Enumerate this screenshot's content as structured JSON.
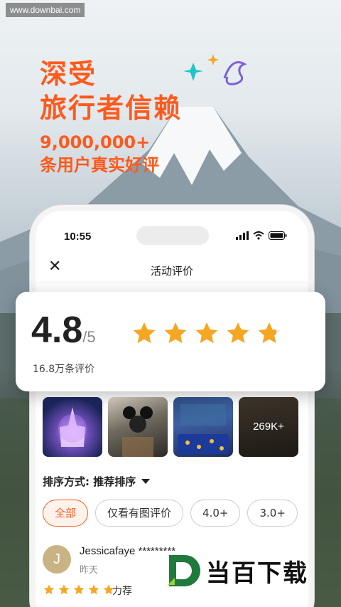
{
  "watermark": "www.downbai.com",
  "headline": {
    "line1": "深受",
    "line2": "旅行者信赖",
    "line3": "9,000,000+",
    "line4": "条用户真实好评"
  },
  "colors": {
    "accent": "#ff5a1c",
    "star": "#f5a623"
  },
  "status_bar": {
    "time": "10:55",
    "icons": [
      "signal-icon",
      "wifi-icon",
      "battery-icon"
    ]
  },
  "nav": {
    "title": "活动评价",
    "close_icon": "close-icon"
  },
  "rating": {
    "score": "4.8",
    "out_of": "/5",
    "count": "16.8万条评价",
    "stars": 4.8
  },
  "photos": [
    {
      "alt": "castle-night"
    },
    {
      "alt": "mickey-ears-crowd"
    },
    {
      "alt": "ride-interior"
    },
    {
      "alt": "food-photo",
      "overlay": "269K+"
    }
  ],
  "sort": {
    "label": "排序方式: 推荐排序"
  },
  "filters": [
    "全部",
    "仅看有图评价",
    "4.0+",
    "3.0+"
  ],
  "review": {
    "avatar_letter": "J",
    "name": "Jessicafaye *********",
    "date": "昨天",
    "stars": 5,
    "tag": "力荐"
  },
  "logo": {
    "text": "当百下载"
  }
}
